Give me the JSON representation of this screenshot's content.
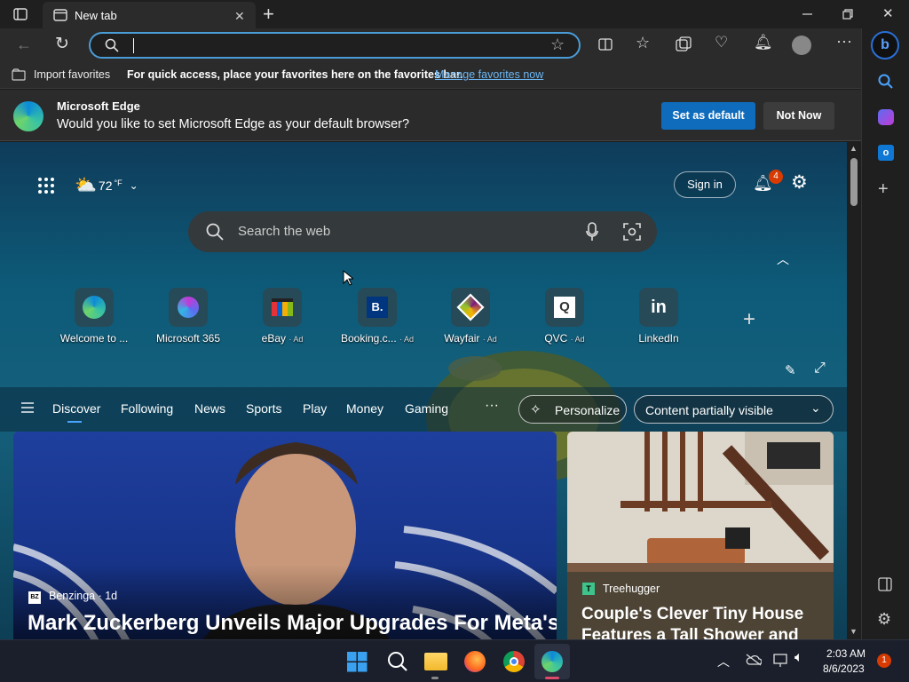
{
  "tab": {
    "title": "New tab"
  },
  "address": {
    "value": "",
    "placeholder": ""
  },
  "favbar": {
    "import": "Import favorites",
    "hint": "For quick access, place your favorites here on the favorites bar.",
    "manage": "Manage favorites now"
  },
  "prompt": {
    "title": "Microsoft Edge",
    "message": "Would you like to set Microsoft Edge as your default browser?",
    "set_default": "Set as default",
    "not_now": "Not Now"
  },
  "page": {
    "weather": "72",
    "weather_unit": "°F",
    "signin": "Sign in",
    "notif_count": "4",
    "search_placeholder": "Search the web",
    "tiles": [
      {
        "label": "Welcome to ...",
        "ad": ""
      },
      {
        "label": "Microsoft 365",
        "ad": ""
      },
      {
        "label": "eBay",
        "ad": "· Ad"
      },
      {
        "label": "Booking.c...",
        "ad": "· Ad"
      },
      {
        "label": "Wayfair",
        "ad": "· Ad"
      },
      {
        "label": "QVC",
        "ad": "· Ad"
      },
      {
        "label": "LinkedIn",
        "ad": ""
      }
    ],
    "nav": [
      "Discover",
      "Following",
      "News",
      "Sports",
      "Play",
      "Money",
      "Gaming"
    ],
    "personalize": "Personalize",
    "visibility": "Content partially visible",
    "main_card": {
      "source": "Benzinga · 1d",
      "headline": "Mark Zuckerberg Unveils Major Upgrades For Meta's"
    },
    "side_card": {
      "source": "Treehugger",
      "headline": "Couple's Clever Tiny House Features a Tall Shower and"
    }
  },
  "taskbar": {
    "time": "2:03 AM",
    "date": "8/6/2023",
    "badge": "1"
  },
  "colors": {
    "accent": "#0f6cbd",
    "link": "#6cb8f6",
    "notif": "#d83b01"
  }
}
